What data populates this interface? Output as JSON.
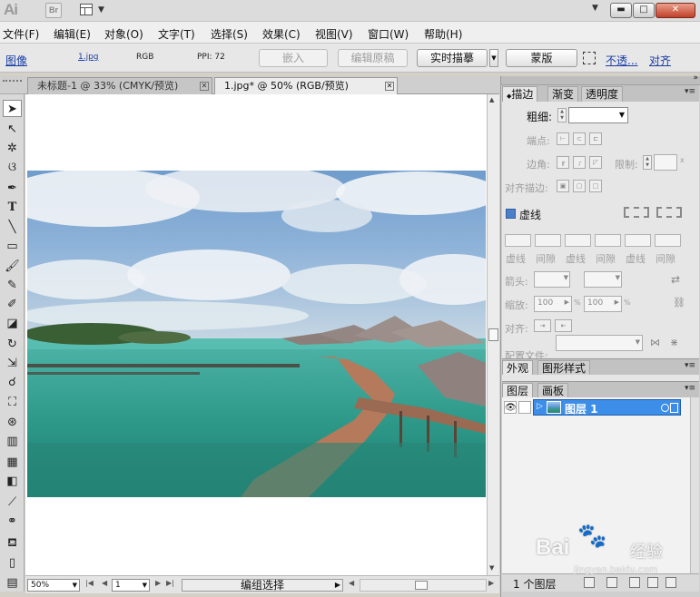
{
  "colors": {
    "accent": "#3d8ee8",
    "link": "#1a3ea5",
    "close": "#c2402a"
  },
  "titlebar": {
    "app_logo": "Ai",
    "bridge_label": "Br",
    "icons": [
      "workspace-switcher-icon",
      "minimize-icon",
      "maximize-icon",
      "close-icon"
    ]
  },
  "menus": [
    "文件(F)",
    "编辑(E)",
    "对象(O)",
    "文字(T)",
    "选择(S)",
    "效果(C)",
    "视图(V)",
    "窗口(W)",
    "帮助(H)"
  ],
  "control": {
    "object_type": "图像",
    "file_name": "1.jpg",
    "color_mode": "RGB",
    "ppi": "PPI: 72",
    "embed": "嵌入",
    "edit_original": "编辑原稿",
    "live_trace": "实时描摹",
    "mask": "蒙版",
    "opacity": "不透...",
    "align": "对齐"
  },
  "doc_tabs": [
    {
      "label": "未标题-1 @ 33% (CMYK/预览)",
      "close": "✕"
    },
    {
      "label": "1.jpg* @ 50% (RGB/预览)",
      "close": "✕"
    }
  ],
  "tools": [
    "selection-tool",
    "direct-selection-tool",
    "magic-wand-tool",
    "lasso-tool",
    "pen-tool",
    "type-tool",
    "line-tool",
    "rectangle-tool",
    "paintbrush-tool",
    "pencil-tool",
    "blob-brush-tool",
    "eraser-tool",
    "rotate-tool",
    "scale-tool",
    "warp-tool",
    "free-transform-tool",
    "symbol-sprayer-tool",
    "column-graph-tool",
    "mesh-tool",
    "gradient-tool",
    "eyedropper-tool",
    "blend-tool",
    "live-paint-bucket-tool",
    "artboard-tool",
    "slice-tool"
  ],
  "status": {
    "zoom": "50%",
    "artboard": "1",
    "tool_name": "编组选择"
  },
  "stroke_panel": {
    "tabs": [
      "描边",
      "渐变",
      "透明度"
    ],
    "weight_label": "粗细:",
    "cap_label": "端点:",
    "corner_label": "边角:",
    "limit_label": "限制:",
    "limit_unit": "x",
    "align_label": "对齐描边:",
    "dashed_label": "虚线",
    "dash_labels": [
      "虚线",
      "间隙",
      "虚线",
      "间隙",
      "虚线",
      "间隙"
    ],
    "arrow_label": "箭头:",
    "scale_label": "缩放:",
    "scale_value_1": "100",
    "scale_value_2": "100",
    "percent": "%",
    "align2_label": "对齐:",
    "profile_label": "配置文件:"
  },
  "appearance_tabs": [
    "外观",
    "图形样式"
  ],
  "layers": {
    "tabs": [
      "图层",
      "画板"
    ],
    "items": [
      {
        "name": "图层 1"
      }
    ],
    "footer": "1 个图层"
  },
  "watermark": {
    "brand": "Bai",
    "brand2": "经验",
    "url": "jingyan.baidu.com"
  }
}
